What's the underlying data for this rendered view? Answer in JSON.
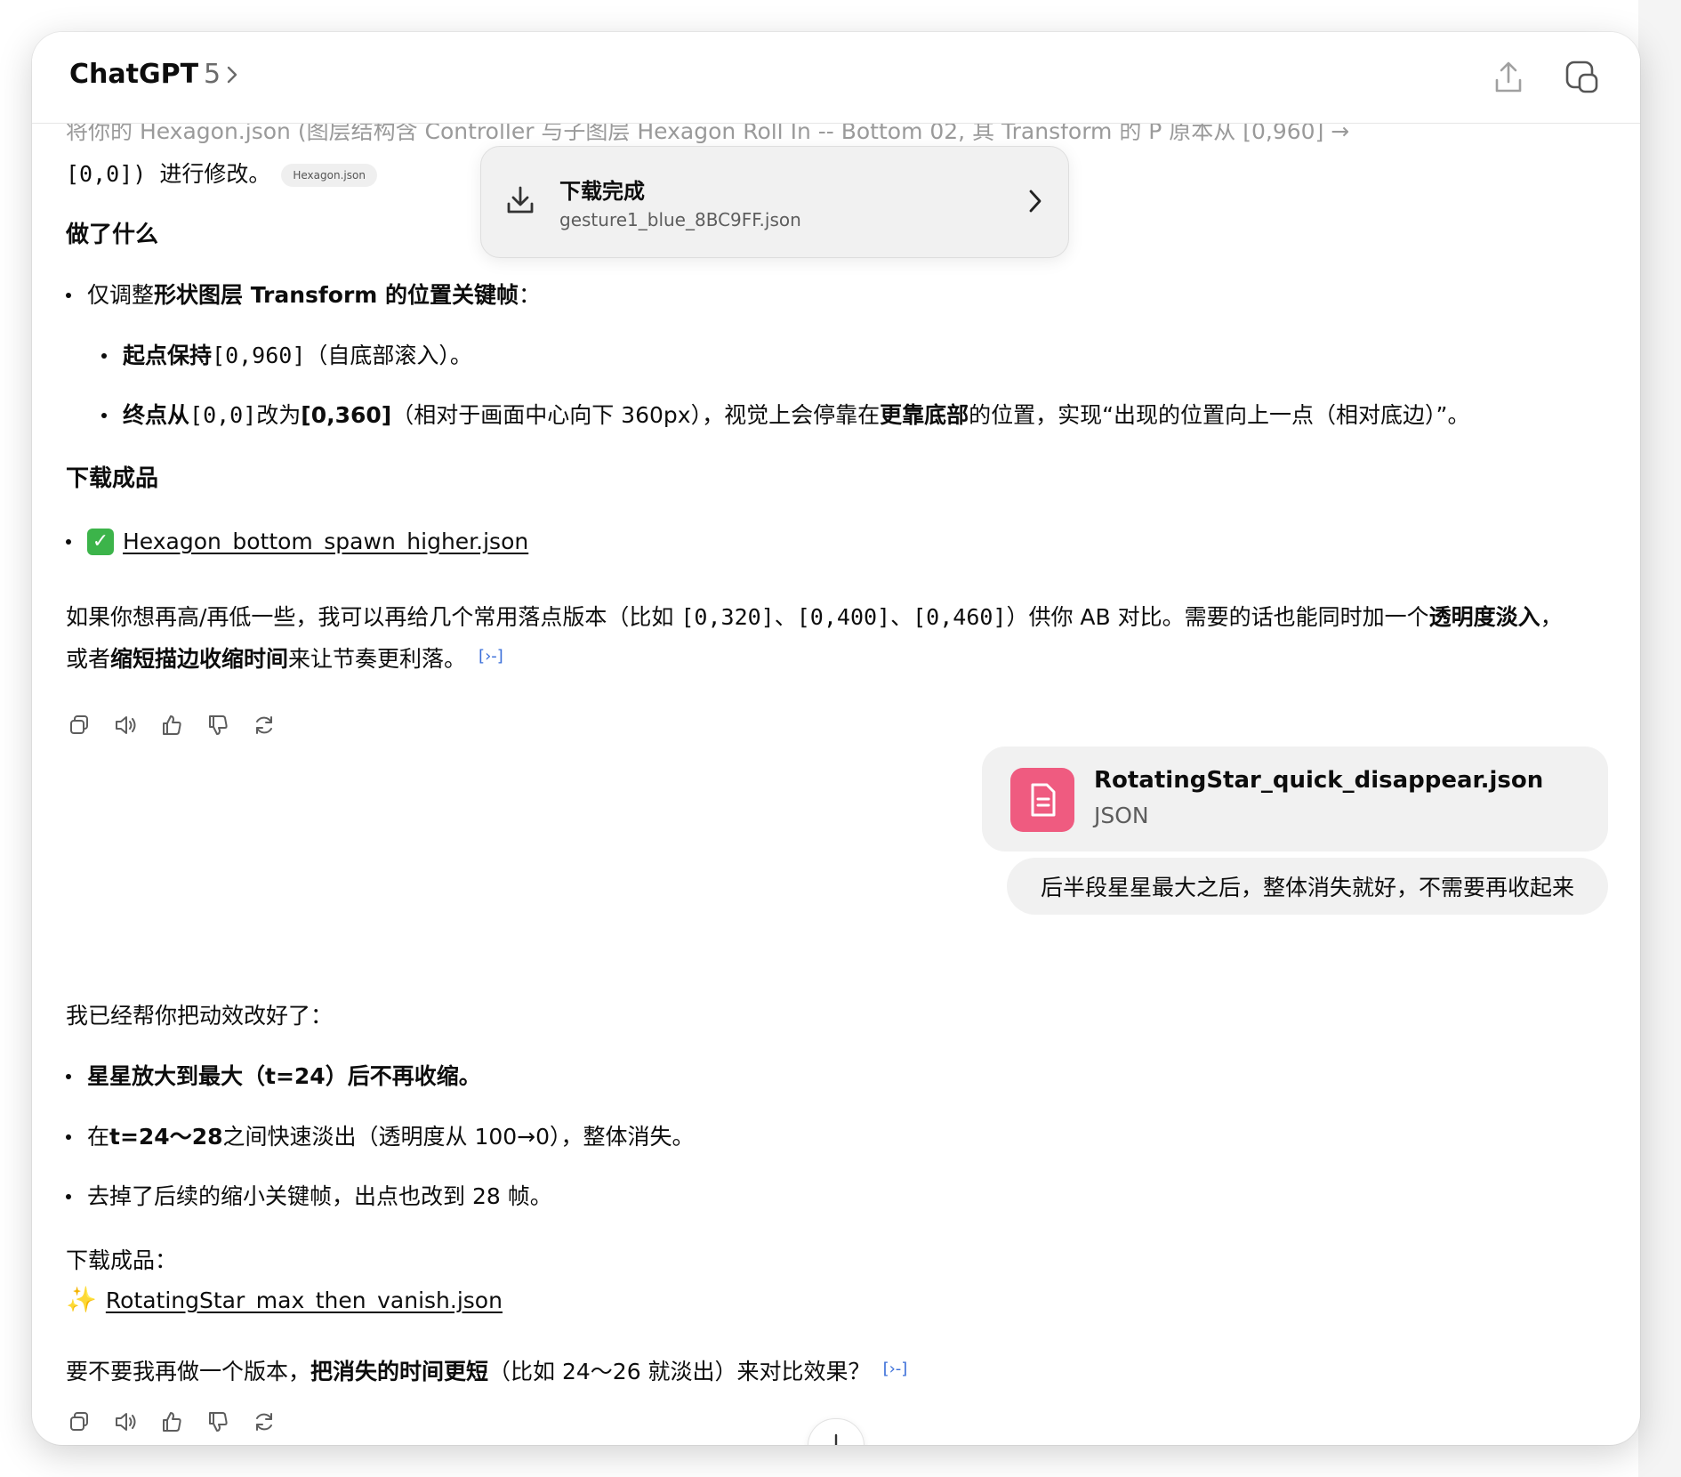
{
  "header": {
    "model_name": "ChatGPT",
    "model_version": "5",
    "share_icon": "share-icon",
    "new_chat_icon": "new-chat-icon"
  },
  "toast": {
    "title": "下载完成",
    "filename": "gesture1_blue_8BC9FF.json"
  },
  "msg1": {
    "cut_line_a": "[0,0]) 进行修改。",
    "cut_top": "将你的 Hexagon.json (图层结构含 Controller 与子图层 Hexagon Roll In -- Bottom 02, 其 Transform 的 P 原本从 [0,960] →",
    "chip": "Hexagon.json",
    "h_done": "做了什么",
    "b1_pre": "仅调整 ",
    "b1_bold": "形状图层 Transform 的位置关键帧",
    "b1_post": "：",
    "s1_bold": "起点保持",
    "s1_code": " [0,960]",
    "s1_post": "（自底部滚入）。",
    "s2_bold": "终点从",
    "s2_code": " [0,0] ",
    "s2_mid": "改为 ",
    "s2_bold2": "[0,360]",
    "s2_post": "（相对于画面中心向下 360px），视觉上会停靠在",
    "s2_bold3": "更靠底部",
    "s2_post2": "的位置，实现“出现的位置向上一点（相对底边）”。",
    "h_download": "下载成品",
    "link1": "Hexagon_bottom_spawn_higher.json",
    "p1_a": "如果你想再高/再低一些，我可以再给几个常用落点版本（比如 ",
    "p1_code1": "[0,320]",
    "p1_sep1": "、",
    "p1_code2": "[0,400]",
    "p1_sep2": "、",
    "p1_code3": "[0,460]",
    "p1_b": "）供你 AB 对比。需要的话也能同时加一个",
    "p1_bold": "透明度淡入",
    "p1_c": "，",
    "p2_a": "或者",
    "p2_bold": "缩短描边收缩时间",
    "p2_b": "来让节奏更利落。"
  },
  "user_msg": {
    "file_name": "RotatingStar_quick_disappear.json",
    "file_type": "JSON",
    "text": "后半段星星最大之后，整体消失就好，不需要再收起来"
  },
  "msg2": {
    "intro": "我已经帮你把动效改好了：",
    "b1": "星星放大到最大（t=24）后不再收缩。",
    "b2_pre": "在 ",
    "b2_bold": "t=24～28",
    "b2_post": " 之间快速淡出（透明度从 100→0），整体消失。",
    "b3": "去掉了后续的缩小关键帧，出点也改到 28 帧。",
    "dl_label": "下载成品：",
    "link": "RotatingStar_max_then_vanish.json",
    "q_a": "要不要我再做一个版本，",
    "q_bold": "把消失的时间更短",
    "q_b": "（比如 24～26 就淡出）来对比效果？"
  },
  "actions": [
    "copy-icon",
    "read-aloud-icon",
    "thumbs-up-icon",
    "thumbs-down-icon",
    "regenerate-icon"
  ],
  "colors": {
    "file_icon_bg": "#ef5b80",
    "bubble_bg": "#f1f1f1",
    "link_blue": "#3b6fd9"
  }
}
